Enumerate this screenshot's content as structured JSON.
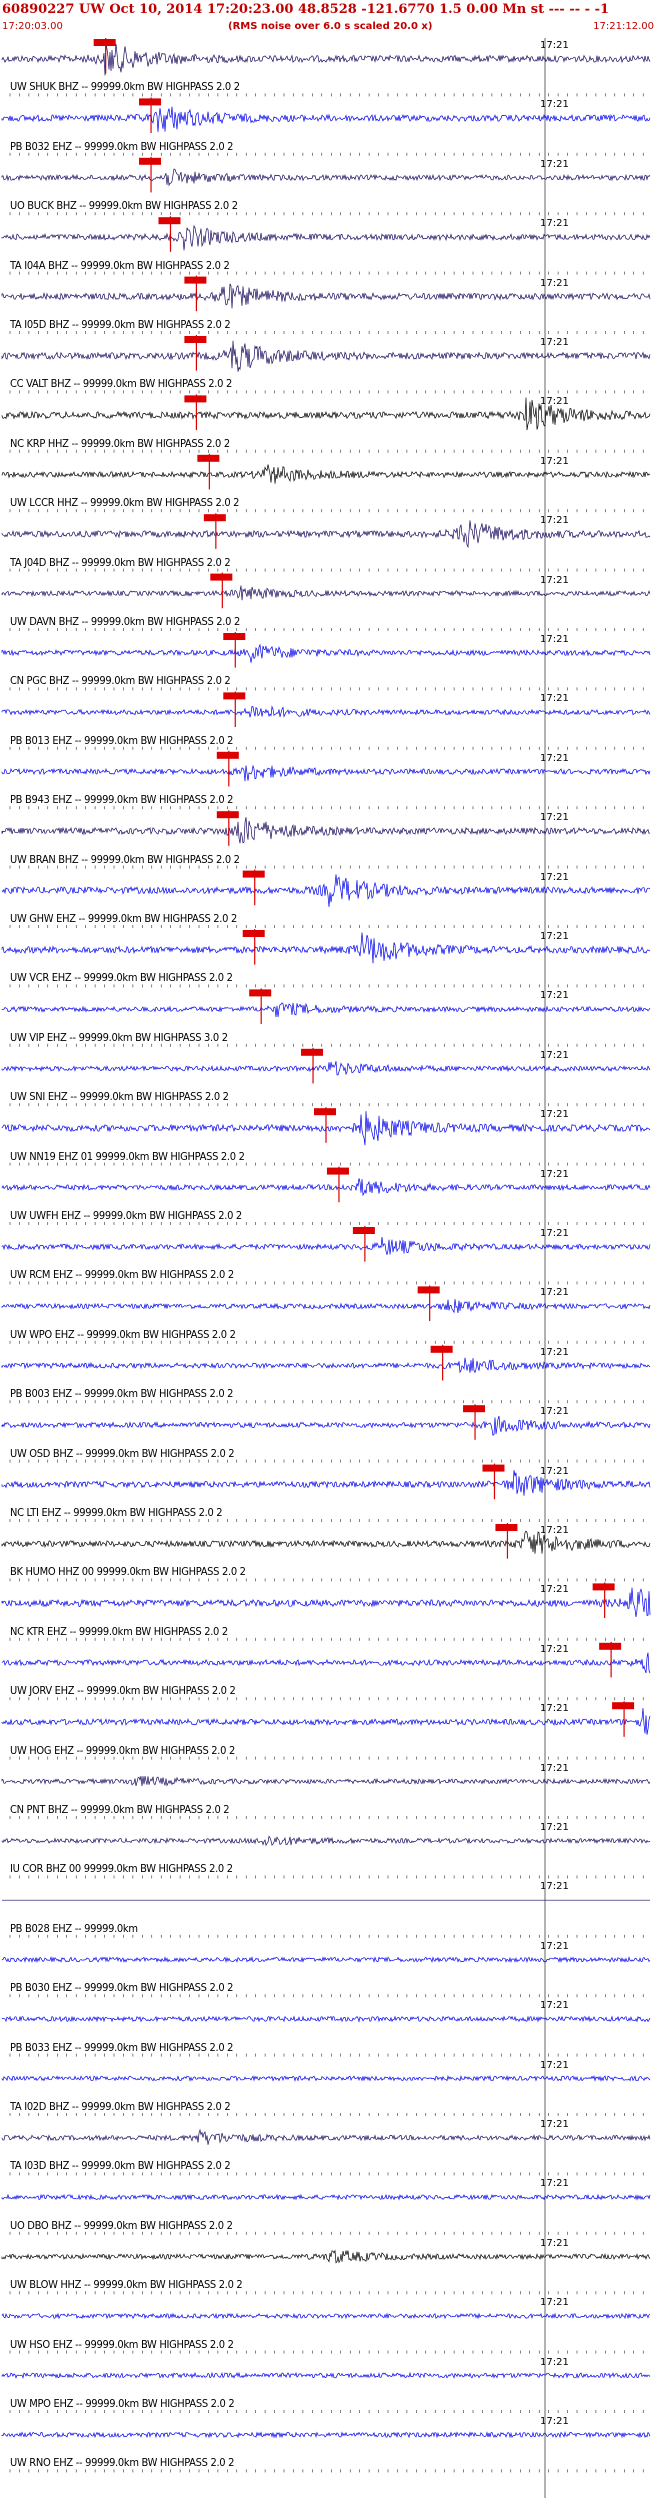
{
  "header": {
    "title": "60890227 UW Oct 10, 2014 17:20:23.00   48.8528 -121.6770  1.5 0.00 Mn st --- -- -  -1",
    "start_time": "17:20:03.00",
    "note": "(RMS noise over 6.0 s scaled 20.0 x)",
    "end_time": "17:21:12.00"
  },
  "tick_label": "17:21",
  "colors": {
    "header": "#c00000",
    "pick": "#dd0000",
    "blue": "#0000ee",
    "navy": "#1a0a5e",
    "black": "#000000"
  },
  "traces": [
    {
      "label": "UW SHUK BHZ -- 99999.0km BW  HIGHPASS  2.0  2",
      "color": "navy",
      "pick": 0.16,
      "burst": 0.16,
      "amp": 1.0
    },
    {
      "label": "PB B032 EHZ -- 99999.0km BW  HIGHPASS  2.0  2",
      "color": "blue",
      "pick": 0.23,
      "burst": 0.24,
      "amp": 0.9
    },
    {
      "label": "UO BUCK BHZ -- 99999.0km BW  HIGHPASS  2.0  2",
      "color": "navy",
      "pick": 0.23,
      "burst": 0.25,
      "amp": 0.5
    },
    {
      "label": "TA I04A BHZ -- 99999.0km BW  HIGHPASS  2.0  2",
      "color": "navy",
      "pick": 0.26,
      "burst": 0.28,
      "amp": 0.7
    },
    {
      "label": "TA I05D BHZ -- 99999.0km BW  HIGHPASS  2.0  2",
      "color": "navy",
      "pick": 0.3,
      "burst": 0.33,
      "amp": 0.9
    },
    {
      "label": "CC VALT BHZ -- 99999.0km BW  HIGHPASS  2.0  2",
      "color": "navy",
      "pick": 0.3,
      "burst": 0.35,
      "amp": 1.0
    },
    {
      "label": "NC KRP HHZ -- 99999.0km BW  HIGHPASS  2.0  2",
      "color": "black",
      "pick": 0.3,
      "burst": 0.8,
      "amp": 1.0
    },
    {
      "label": "UW LCCR HHZ -- 99999.0km BW  HIGHPASS  2.0  2",
      "color": "black",
      "pick": 0.32,
      "burst": 0.4,
      "amp": 0.6
    },
    {
      "label": "TA J04D BHZ -- 99999.0km BW  HIGHPASS  2.0  2",
      "color": "navy",
      "pick": 0.33,
      "burst": 0.7,
      "amp": 0.9
    },
    {
      "label": "UW DAVN BHZ -- 99999.0km BW  HIGHPASS  2.0  2",
      "color": "navy",
      "pick": 0.34,
      "burst": 0.36,
      "amp": 0.4
    },
    {
      "label": "CN PGC BHZ -- 99999.0km BW  HIGHPASS  2.0  2",
      "color": "blue",
      "pick": 0.36,
      "burst": 0.38,
      "amp": 0.5
    },
    {
      "label": "PB B013 EHZ -- 99999.0km BW  HIGHPASS  2.0  2",
      "color": "blue",
      "pick": 0.36,
      "burst": 0.38,
      "amp": 0.4
    },
    {
      "label": "PB B943 EHZ -- 99999.0km BW  HIGHPASS  2.0  2",
      "color": "blue",
      "pick": 0.35,
      "burst": 0.37,
      "amp": 0.5
    },
    {
      "label": "UW BRAN BHZ -- 99999.0km BW  HIGHPASS  2.0  2",
      "color": "navy",
      "pick": 0.35,
      "burst": 0.36,
      "amp": 0.9
    },
    {
      "label": "UW GHW EHZ -- 99999.0km BW  HIGHPASS  2.0  2",
      "color": "blue",
      "pick": 0.39,
      "burst": 0.5,
      "amp": 1.0
    },
    {
      "label": "UW VCR EHZ -- 99999.0km BW  HIGHPASS  2.0  2",
      "color": "blue",
      "pick": 0.39,
      "burst": 0.55,
      "amp": 1.0
    },
    {
      "label": "UW VIP EHZ -- 99999.0km BW  HIGHPASS  3.0  2",
      "color": "blue",
      "pick": 0.4,
      "burst": 0.42,
      "amp": 0.4
    },
    {
      "label": "UW SNI EHZ -- 99999.0km BW  HIGHPASS  2.0  2",
      "color": "blue",
      "pick": 0.48,
      "burst": 0.5,
      "amp": 0.4
    },
    {
      "label": "UW NN19 EHZ 01 99999.0km BW  HIGHPASS  2.0  2",
      "color": "blue",
      "pick": 0.5,
      "burst": 0.55,
      "amp": 1.0
    },
    {
      "label": "UW UWFH EHZ -- 99999.0km BW  HIGHPASS  2.0  2",
      "color": "blue",
      "pick": 0.52,
      "burst": 0.54,
      "amp": 0.5
    },
    {
      "label": "UW RCM EHZ -- 99999.0km BW  HIGHPASS  2.0  2",
      "color": "blue",
      "pick": 0.56,
      "burst": 0.58,
      "amp": 0.5
    },
    {
      "label": "UW WPO EHZ -- 99999.0km BW  HIGHPASS  2.0  2",
      "color": "blue",
      "pick": 0.66,
      "burst": 0.68,
      "amp": 0.4
    },
    {
      "label": "PB B003 EHZ -- 99999.0km BW  HIGHPASS  2.0  2",
      "color": "blue",
      "pick": 0.68,
      "burst": 0.7,
      "amp": 0.5
    },
    {
      "label": "UW OSD BHZ -- 99999.0km BW  HIGHPASS  2.0  2",
      "color": "blue",
      "pick": 0.73,
      "burst": 0.75,
      "amp": 0.5
    },
    {
      "label": "NC LTI EHZ -- 99999.0km BW  HIGHPASS  2.0  2",
      "color": "blue",
      "pick": 0.76,
      "burst": 0.78,
      "amp": 0.8
    },
    {
      "label": "BK HUMO HHZ 00 99999.0km BW  HIGHPASS  2.0  2",
      "color": "black",
      "pick": 0.78,
      "burst": 0.8,
      "amp": 0.8
    },
    {
      "label": "NC KTR EHZ -- 99999.0km BW  HIGHPASS  2.0  2",
      "color": "blue",
      "pick": 0.93,
      "burst": 0.96,
      "amp": 1.0
    },
    {
      "label": "UW JORV EHZ -- 99999.0km BW  HIGHPASS  2.0  2",
      "color": "blue",
      "pick": 0.94,
      "burst": 0.98,
      "amp": 0.6
    },
    {
      "label": "UW HOG EHZ -- 99999.0km BW  HIGHPASS  2.0  2",
      "color": "blue",
      "pick": 0.96,
      "burst": 0.98,
      "amp": 0.7
    },
    {
      "label": "CN PNT BHZ -- 99999.0km BW  HIGHPASS  2.0  2",
      "color": "navy",
      "pick": null,
      "burst": 0.2,
      "amp": 0.3
    },
    {
      "label": "IU COR BHZ 00 99999.0km BW  HIGHPASS  2.0  2",
      "color": "navy",
      "pick": null,
      "burst": 0.4,
      "amp": 0.3
    },
    {
      "label": "PB B028 EHZ -- 99999.0km",
      "color": "navy",
      "pick": null,
      "burst": null,
      "amp": 0.0
    },
    {
      "label": "PB B030 EHZ -- 99999.0km BW  HIGHPASS  2.0  2",
      "color": "blue",
      "pick": null,
      "burst": null,
      "amp": 0.3
    },
    {
      "label": "PB B033 EHZ -- 99999.0km BW  HIGHPASS  2.0  2",
      "color": "blue",
      "pick": null,
      "burst": null,
      "amp": 0.4
    },
    {
      "label": "TA I02D BHZ -- 99999.0km BW  HIGHPASS  2.0  2",
      "color": "blue",
      "pick": null,
      "burst": null,
      "amp": 0.3
    },
    {
      "label": "TA I03D BHZ -- 99999.0km BW  HIGHPASS  2.0  2",
      "color": "navy",
      "pick": null,
      "burst": 0.3,
      "amp": 0.4
    },
    {
      "label": "UO DBO BHZ -- 99999.0km BW  HIGHPASS  2.0  2",
      "color": "blue",
      "pick": null,
      "burst": null,
      "amp": 0.3
    },
    {
      "label": "UW BLOW HHZ -- 99999.0km BW  HIGHPASS  2.0  2",
      "color": "black",
      "pick": null,
      "burst": 0.5,
      "amp": 0.4
    },
    {
      "label": "UW HSO EHZ -- 99999.0km BW  HIGHPASS  2.0  2",
      "color": "blue",
      "pick": null,
      "burst": null,
      "amp": 0.3
    },
    {
      "label": "UW MPO EHZ -- 99999.0km BW  HIGHPASS  2.0  2",
      "color": "blue",
      "pick": null,
      "burst": null,
      "amp": 0.4
    },
    {
      "label": "UW RNO EHZ -- 99999.0km BW  HIGHPASS  2.0  2",
      "color": "blue",
      "pick": null,
      "burst": null,
      "amp": 0.4
    }
  ]
}
